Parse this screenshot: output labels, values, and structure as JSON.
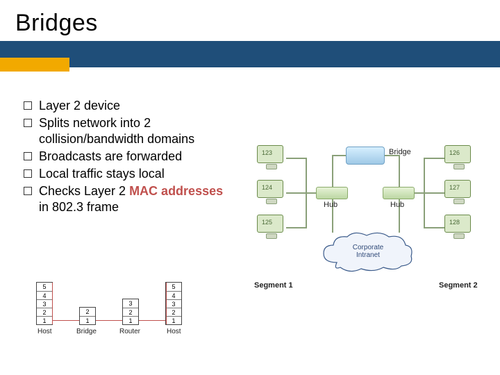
{
  "title": "Bridges",
  "bullets": {
    "b0": "Layer 2 device",
    "b1": "Splits network into 2 collision/bandwidth domains",
    "b2": "Broadcasts are forwarded",
    "b3": "Local traffic stays local",
    "b4_a": "Checks Layer 2 ",
    "b4_mac": "MAC addresses",
    "b4_b": " in 802.3 frame"
  },
  "diagram": {
    "pc123": "123",
    "pc124": "124",
    "pc125": "125",
    "pc126": "126",
    "pc127": "127",
    "pc128": "128",
    "bridge": "Bridge",
    "hub": "Hub",
    "cloud1": "Corporate",
    "cloud2": "Intranet",
    "seg1": "Segment 1",
    "seg2": "Segment 2"
  },
  "osi": {
    "n5": "5",
    "n4": "4",
    "n3": "3",
    "n2": "2",
    "n1": "1",
    "host": "Host",
    "bridge": "Bridge",
    "router": "Router"
  }
}
